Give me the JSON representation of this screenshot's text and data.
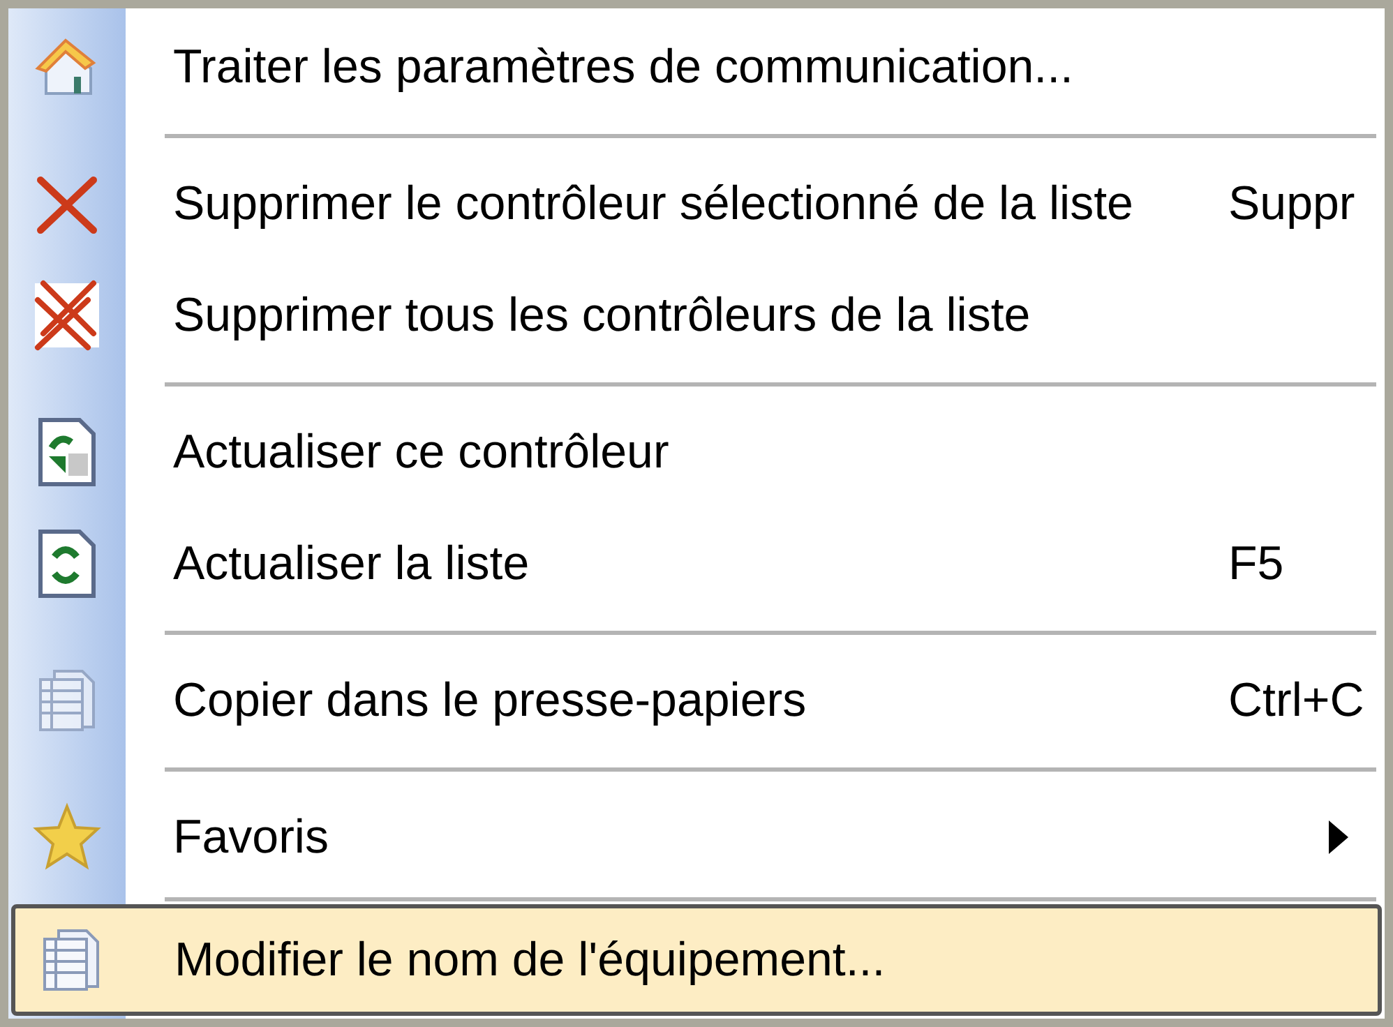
{
  "menu": {
    "groups": [
      {
        "items": [
          {
            "label": "Traiter les paramètres de communication...",
            "selected": false
          }
        ]
      },
      {
        "items": [
          {
            "label": "Supprimer le contrôleur sélectionné de la liste",
            "shortcut": "Suppr",
            "selected": false
          },
          {
            "label": "Supprimer tous les contrôleurs de la liste",
            "selected": false
          }
        ]
      },
      {
        "items": [
          {
            "label": "Actualiser ce contrôleur",
            "selected": false
          },
          {
            "label": "Actualiser la liste",
            "shortcut": "F5",
            "selected": false
          }
        ]
      },
      {
        "items": [
          {
            "label": "Copier dans le presse-papiers",
            "shortcut": "Ctrl+C",
            "selected": false
          }
        ]
      },
      {
        "items": [
          {
            "label": "Favoris",
            "submenu": true,
            "selected": false
          }
        ]
      },
      {
        "items": [
          {
            "label": "Modifier le nom de l'équipement...",
            "selected": true
          }
        ]
      }
    ]
  }
}
